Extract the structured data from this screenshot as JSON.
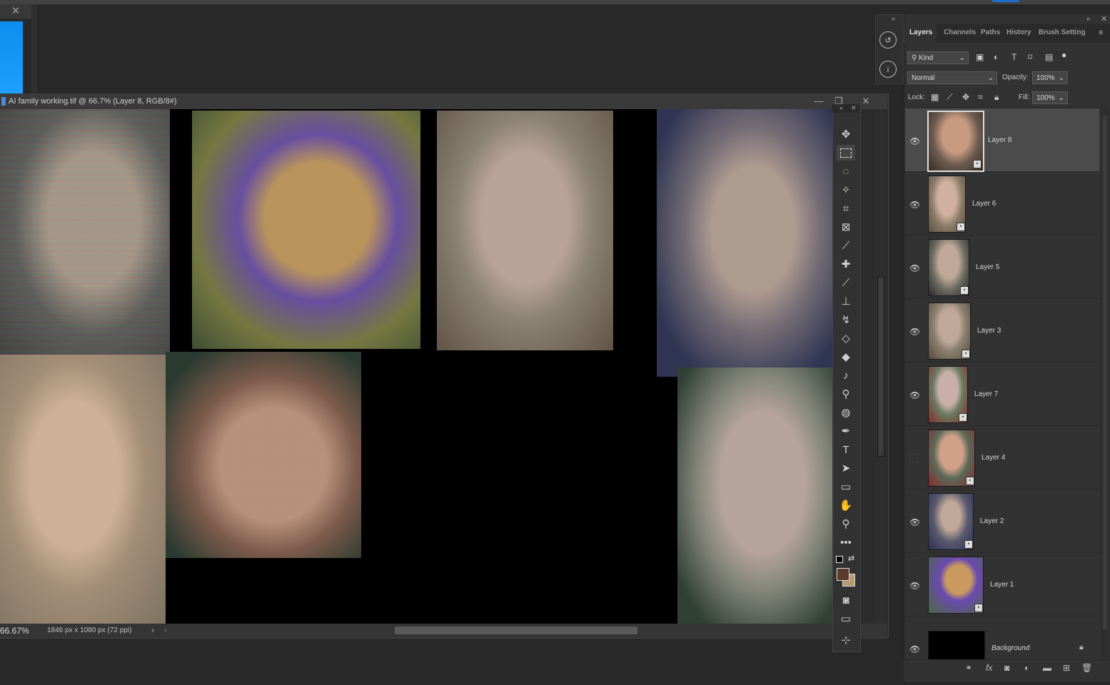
{
  "document": {
    "title": "AI family working.tif @ 66.7% (Layer 8, RGB/8#)",
    "zoom": "66.67%",
    "dimensions": "1846 px x 1080 px (72 ppi)",
    "minimize": "—",
    "restore": "❐",
    "close": "✕"
  },
  "app_tab_close": "✕",
  "panel_tabs": [
    "Layers",
    "Channels",
    "Paths",
    "History",
    "Brush Setting"
  ],
  "filter": {
    "kind_label": "Kind"
  },
  "blend": {
    "mode": "Normal",
    "opacity_label": "Opacity:",
    "opacity": "100%"
  },
  "lock": {
    "label": "Lock:",
    "fill_label": "Fill:",
    "fill": "100%"
  },
  "layers": [
    {
      "name": "Layer 8",
      "visible": true,
      "selected": true
    },
    {
      "name": "Layer 6",
      "visible": true,
      "selected": false
    },
    {
      "name": "Layer 5",
      "visible": true,
      "selected": false
    },
    {
      "name": "Layer 3",
      "visible": true,
      "selected": false
    },
    {
      "name": "Layer 7",
      "visible": true,
      "selected": false
    },
    {
      "name": "Layer 4",
      "visible": false,
      "selected": false
    },
    {
      "name": "Layer 2",
      "visible": true,
      "selected": false
    },
    {
      "name": "Layer 1",
      "visible": true,
      "selected": false
    },
    {
      "name": "Background",
      "visible": true,
      "selected": false
    }
  ],
  "colors": {
    "foreground": "#5a3a28",
    "background": "#b89a70",
    "accent": "#1c6fc7"
  }
}
